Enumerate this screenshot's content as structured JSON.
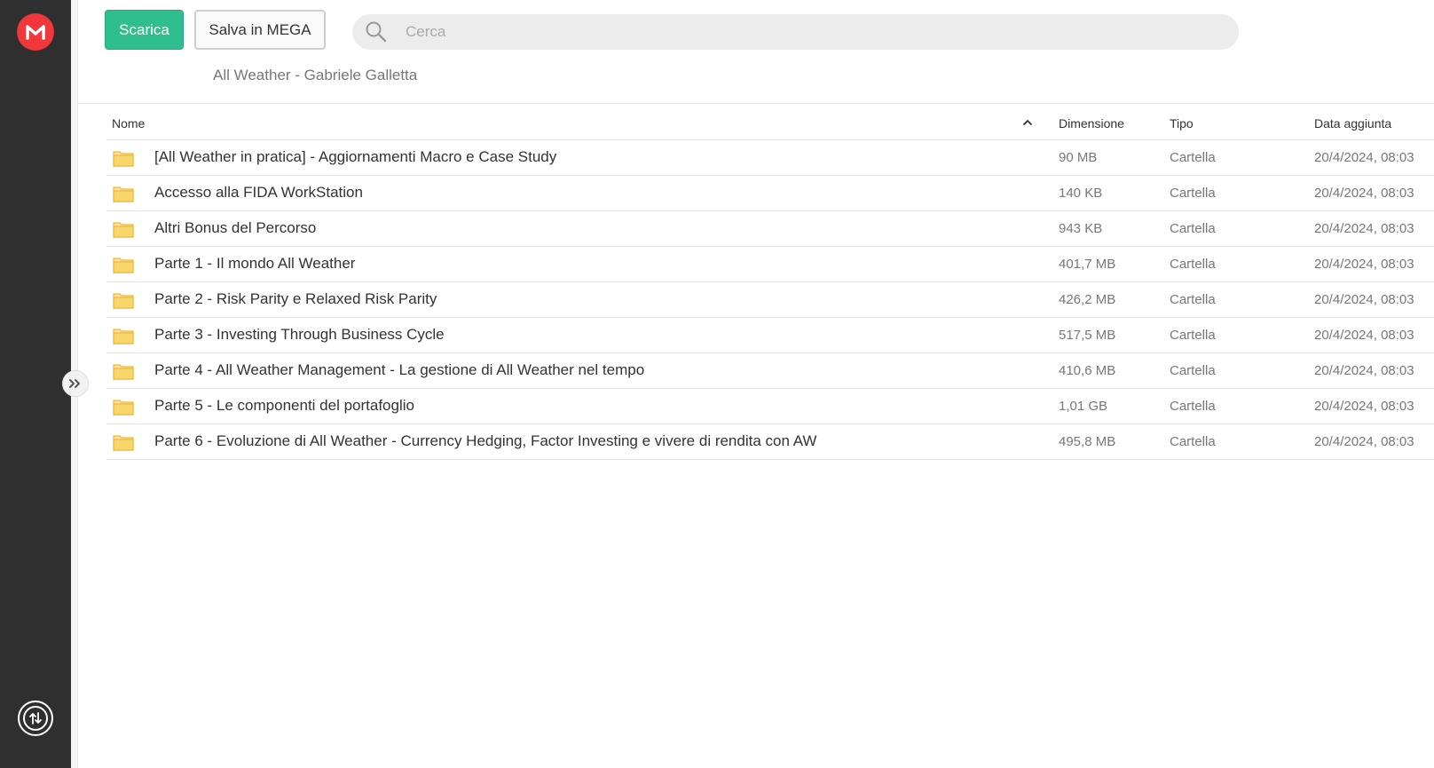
{
  "toolbar": {
    "download_label": "Scarica",
    "save_label": "Salva in MEGA",
    "search_placeholder": "Cerca"
  },
  "breadcrumb": "All Weather - Gabriele Galletta",
  "columns": {
    "name": "Nome",
    "size": "Dimensione",
    "type": "Tipo",
    "date": "Data aggiunta"
  },
  "rows": [
    {
      "name": "[All Weather in pratica] - Aggiornamenti Macro e Case Study",
      "size": "90 MB",
      "type": "Cartella",
      "date": "20/4/2024, 08:03"
    },
    {
      "name": "Accesso alla FIDA WorkStation",
      "size": "140 KB",
      "type": "Cartella",
      "date": "20/4/2024, 08:03"
    },
    {
      "name": "Altri Bonus del Percorso",
      "size": "943 KB",
      "type": "Cartella",
      "date": "20/4/2024, 08:03"
    },
    {
      "name": "Parte 1 - Il mondo All Weather",
      "size": "401,7 MB",
      "type": "Cartella",
      "date": "20/4/2024, 08:03"
    },
    {
      "name": "Parte 2 - Risk Parity e Relaxed Risk Parity",
      "size": "426,2 MB",
      "type": "Cartella",
      "date": "20/4/2024, 08:03"
    },
    {
      "name": "Parte 3 - Investing Through Business Cycle",
      "size": "517,5 MB",
      "type": "Cartella",
      "date": "20/4/2024, 08:03"
    },
    {
      "name": "Parte 4 - All Weather Management - La gestione di All Weather nel tempo",
      "size": "410,6 MB",
      "type": "Cartella",
      "date": "20/4/2024, 08:03"
    },
    {
      "name": "Parte 5 - Le componenti del portafoglio",
      "size": "1,01 GB",
      "type": "Cartella",
      "date": "20/4/2024, 08:03"
    },
    {
      "name": "Parte 6 - Evoluzione di All Weather - Currency Hedging, Factor Investing e vivere di rendita con AW",
      "size": "495,8 MB",
      "type": "Cartella",
      "date": "20/4/2024, 08:03"
    }
  ],
  "colors": {
    "accent": "#2fbf8f",
    "brand": "#f0373a",
    "folder": "#f9d66b"
  }
}
